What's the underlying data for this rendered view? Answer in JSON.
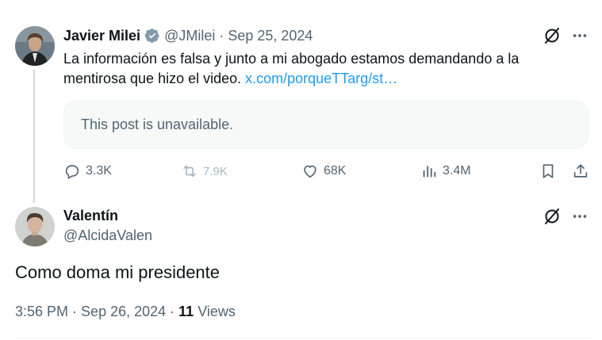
{
  "parent_tweet": {
    "author_name": "Javier Milei",
    "handle": "@JMilei",
    "separator": "·",
    "date": "Sep 25, 2024",
    "text": "La información es falsa y junto a mi abogado estamos demandando a la mentirosa que hizo el video. ",
    "link": "x.com/porqueTTarg/st…",
    "quoted_unavailable": "This post is unavailable.",
    "actions": {
      "replies": "3.3K",
      "reposts": "7.9K",
      "likes": "68K",
      "views": "3.4M"
    },
    "verified_badge_color": "#829aab"
  },
  "reply_tweet": {
    "author_name": "Valentín",
    "handle": "@AlcidaValen",
    "text": "Como doma mi presidente",
    "time": "3:56 PM",
    "separator": "·",
    "date": "Sep 26, 2024",
    "views_count": "11",
    "views_label": "Views"
  },
  "icons": {
    "verified": "verified-badge-icon",
    "grok": "grok-icon",
    "more": "more-icon",
    "reply": "reply-icon",
    "repost": "repost-icon",
    "like": "like-icon",
    "views": "views-icon",
    "bookmark": "bookmark-icon",
    "share": "share-icon"
  },
  "colors": {
    "text_primary": "#0f1419",
    "text_secondary": "#536471",
    "link": "#1d9bf0",
    "thread_line": "#cfd9de"
  }
}
